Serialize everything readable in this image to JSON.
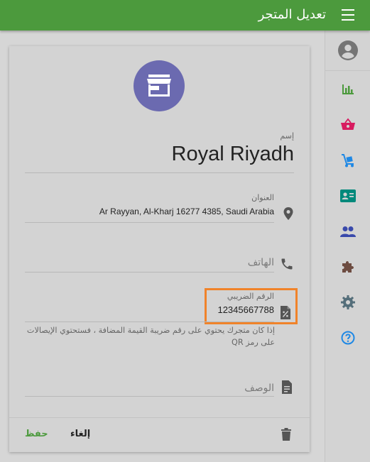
{
  "appbar": {
    "title": "تعديل المتجر",
    "menu_icon": "menu-icon"
  },
  "rail": {
    "items": [
      {
        "name": "avatar",
        "icon": "account-circle-icon",
        "color": "#757575"
      },
      {
        "name": "reports",
        "icon": "bar-chart-icon",
        "color": "#4c9a3d"
      },
      {
        "name": "sales",
        "icon": "basket-icon",
        "color": "#d81b60"
      },
      {
        "name": "purchases",
        "icon": "dolly-icon",
        "color": "#1e88e5"
      },
      {
        "name": "customers",
        "icon": "id-card-icon",
        "color": "#00897b"
      },
      {
        "name": "users",
        "icon": "people-icon",
        "color": "#3949ab"
      },
      {
        "name": "addons",
        "icon": "puzzle-icon",
        "color": "#6d4c41"
      },
      {
        "name": "settings",
        "icon": "gear-icon",
        "color": "#546e7a"
      },
      {
        "name": "help",
        "icon": "help-circle-icon",
        "color": "#1e88e5"
      }
    ]
  },
  "store": {
    "avatar_icon": "store-icon",
    "avatar_color": "#6b6ab0",
    "name_label": "إسم",
    "name_value": "Royal Riyadh",
    "address_label": "العنوان",
    "address_value": "Ar Rayyan, Al-Kharj 16277 4385, Saudi Arabia",
    "phone_placeholder": "الهاتف",
    "tax_label": "الرقم الضريبي",
    "tax_value": "12345667788",
    "tax_note": "إذا كان متجرك يحتوي على رقم ضريبة القيمة المضافة ، فستحتوي الإيصالات على رمز QR",
    "description_placeholder": "الوصف"
  },
  "actions": {
    "save_label": "حفظ",
    "cancel_label": "إلغاء",
    "delete_icon": "trash-icon"
  },
  "colors": {
    "primary": "#4c9a3d",
    "highlight": "#f0832a"
  }
}
